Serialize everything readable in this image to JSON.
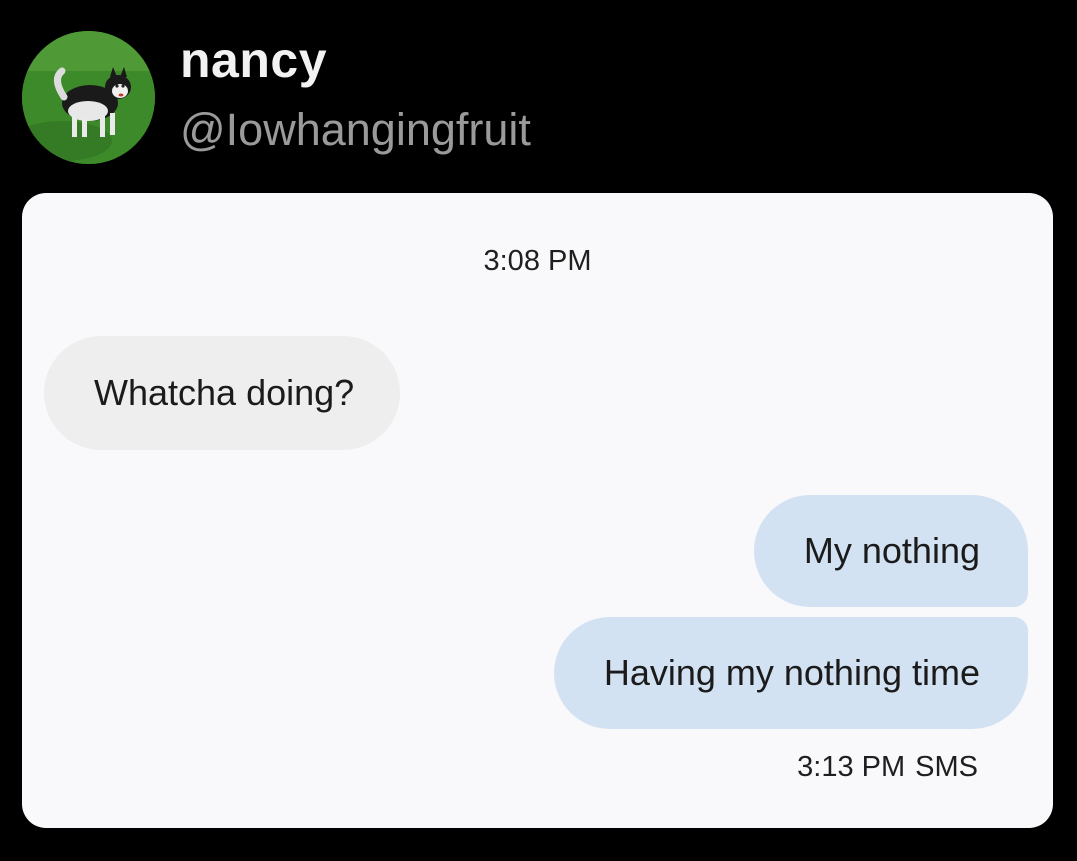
{
  "author": {
    "display_name": "nancy",
    "handle": "@Iowhangingfruit",
    "avatar_icon": "husky-dog-avatar-icon"
  },
  "conversation": {
    "top_timestamp": "3:08 PM",
    "messages": [
      {
        "direction": "incoming",
        "text": "Whatcha doing?"
      },
      {
        "direction": "outgoing",
        "text": "My nothing"
      },
      {
        "direction": "outgoing",
        "text": "Having my nothing time"
      }
    ],
    "bottom_status": {
      "time": "3:13 PM",
      "type": "SMS"
    }
  },
  "colors": {
    "background": "#000000",
    "card": "#f9f9fb",
    "incoming_bubble": "#eeeeef",
    "outgoing_bubble": "#d3e2f2",
    "handle_text": "#9a9a9a"
  }
}
